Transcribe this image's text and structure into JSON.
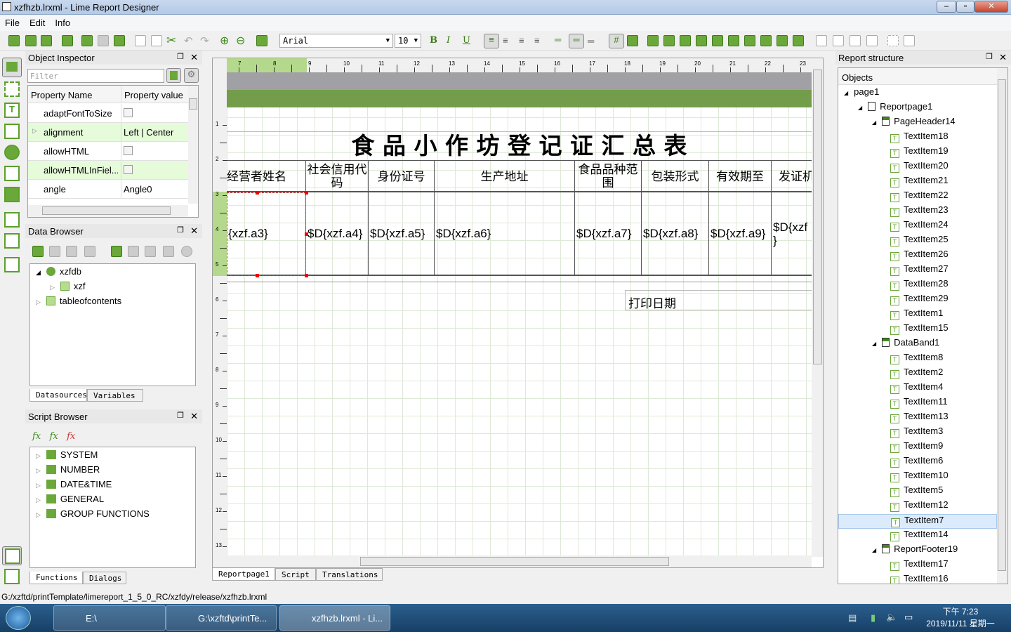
{
  "window": {
    "title": "xzfhzb.lrxml - Lime Report Designer"
  },
  "menu": [
    "File",
    "Edit",
    "Info"
  ],
  "toolbar": {
    "font": "Arial",
    "size": "10",
    "bold": "B",
    "italic": "I",
    "underline": "U"
  },
  "object_inspector": {
    "title": "Object Inspector",
    "filter_placeholder": "Filter",
    "col_name": "Property Name",
    "col_value": "Property value",
    "rows": [
      {
        "name": "adaptFontToSize",
        "value": ""
      },
      {
        "name": "alignment",
        "value": "Left | Center"
      },
      {
        "name": "allowHTML",
        "value": ""
      },
      {
        "name": "allowHTMLInFiel...",
        "value": ""
      },
      {
        "name": "angle",
        "value": "Angle0"
      }
    ]
  },
  "data_browser": {
    "title": "Data Browser",
    "tree": [
      {
        "label": "xzfdb",
        "level": 0
      },
      {
        "label": "xzf",
        "level": 1
      },
      {
        "label": "tableofcontents",
        "level": 0
      }
    ],
    "tabs": [
      "Datasources",
      "Variables"
    ]
  },
  "script_browser": {
    "title": "Script Browser",
    "items": [
      "SYSTEM",
      "NUMBER",
      "DATE&TIME",
      "GENERAL",
      "GROUP FUNCTIONS"
    ],
    "tabs": [
      "Functions",
      "Dialogs"
    ]
  },
  "ruler": {
    "top": [
      "7",
      "8",
      "9",
      "10",
      "11",
      "12",
      "13",
      "14",
      "15",
      "16",
      "17",
      "18",
      "19",
      "20",
      "21",
      "22",
      "23"
    ],
    "left": [
      "1",
      "2",
      "3",
      "4",
      "5",
      "6",
      "7",
      "8",
      "9",
      "10",
      "11",
      "12",
      "13"
    ]
  },
  "report": {
    "title": "食 品 小 作 坊 登 记 证 汇 总 表",
    "headers": [
      "经营者姓名",
      "社会信用代码",
      "身份证号",
      "生产地址",
      "食品品种范围",
      "包装形式",
      "有效期至",
      "发证机"
    ],
    "fields": [
      "{xzf.a3}",
      "$D{xzf.a4}",
      "$D{xzf.a5}",
      "$D{xzf.a6}",
      "$D{xzf.a7}",
      "$D{xzf.a8}",
      "$D{xzf.a9}",
      "$D{xzf\n}"
    ],
    "print_date": "打印日期"
  },
  "editor_tabs": [
    "Reportpage1",
    "Script",
    "Translations"
  ],
  "report_structure": {
    "title": "Report structure",
    "header": "Objects",
    "tree": [
      [
        "page1",
        0,
        "arrow"
      ],
      [
        "Reportpage1",
        1,
        "page"
      ],
      [
        "PageHeader14",
        2,
        "band"
      ],
      [
        "TextItem18",
        3
      ],
      [
        "TextItem19",
        3
      ],
      [
        "TextItem20",
        3
      ],
      [
        "TextItem21",
        3
      ],
      [
        "TextItem22",
        3
      ],
      [
        "TextItem23",
        3
      ],
      [
        "TextItem24",
        3
      ],
      [
        "TextItem25",
        3
      ],
      [
        "TextItem26",
        3
      ],
      [
        "TextItem27",
        3
      ],
      [
        "TextItem28",
        3
      ],
      [
        "TextItem29",
        3
      ],
      [
        "TextItem1",
        3
      ],
      [
        "TextItem15",
        3
      ],
      [
        "DataBand1",
        2,
        "band"
      ],
      [
        "TextItem8",
        3
      ],
      [
        "TextItem2",
        3
      ],
      [
        "TextItem4",
        3
      ],
      [
        "TextItem11",
        3
      ],
      [
        "TextItem13",
        3
      ],
      [
        "TextItem3",
        3
      ],
      [
        "TextItem9",
        3
      ],
      [
        "TextItem6",
        3
      ],
      [
        "TextItem10",
        3
      ],
      [
        "TextItem5",
        3
      ],
      [
        "TextItem12",
        3
      ],
      [
        "TextItem7",
        3,
        "selected"
      ],
      [
        "TextItem14",
        3
      ],
      [
        "ReportFooter19",
        2,
        "band"
      ],
      [
        "TextItem17",
        3
      ],
      [
        "TextItem16",
        3
      ]
    ]
  },
  "status": "G:/xzftd/printTemplate/limereport_1_5_0_RC/xzfdy/release/xzfhzb.lrxml",
  "taskbar": {
    "items": [
      "E:\\",
      "G:\\xzftd\\printTe...",
      "xzfhzb.lrxml - Li..."
    ],
    "time": "下午 7:23",
    "date": "2019/11/11 星期一"
  },
  "colors": {
    "accent": "#6aa83a",
    "band_header": "#739d4b",
    "band_page": "#a1a1a5",
    "row_alt": "#e5fbd9"
  }
}
